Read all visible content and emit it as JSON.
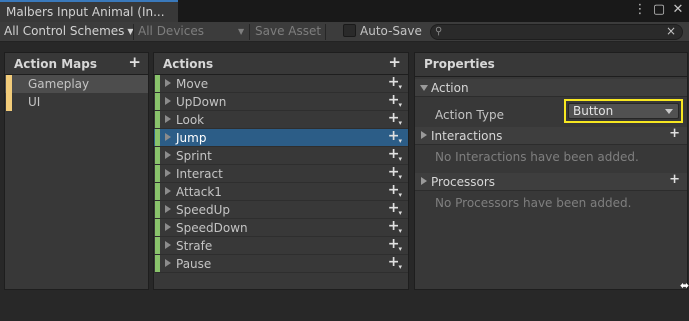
{
  "window": {
    "tab_title": "Malbers Input Animal (In...",
    "icons": [
      "more-icon",
      "maximize-icon",
      "close-icon"
    ],
    "icon_glyphs": {
      "more": "⋮",
      "maximize": "▢",
      "close": "✕"
    }
  },
  "toolbar": {
    "control_schemes": "All Control Schemes",
    "devices": "All Devices",
    "save_asset": "Save Asset",
    "auto_save": "Auto-Save",
    "auto_save_checked": false,
    "search_placeholder": "",
    "search_clear": "×"
  },
  "action_maps": {
    "header": "Action Maps",
    "items": [
      {
        "label": "Gameplay",
        "selected": true
      },
      {
        "label": "UI",
        "selected": false
      }
    ]
  },
  "actions": {
    "header": "Actions",
    "items": [
      {
        "label": "Move",
        "selected": false
      },
      {
        "label": "UpDown",
        "selected": false
      },
      {
        "label": "Look",
        "selected": false
      },
      {
        "label": "Jump",
        "selected": true
      },
      {
        "label": "Sprint",
        "selected": false
      },
      {
        "label": "Interact",
        "selected": false
      },
      {
        "label": "Attack1",
        "selected": false
      },
      {
        "label": "SpeedUp",
        "selected": false
      },
      {
        "label": "SpeedDown",
        "selected": false
      },
      {
        "label": "Strafe",
        "selected": false
      },
      {
        "label": "Pause",
        "selected": false
      }
    ]
  },
  "properties": {
    "header": "Properties",
    "action_section": "Action",
    "action_type_label": "Action Type",
    "action_type_value": "Button",
    "interactions_section": "Interactions",
    "interactions_empty": "No Interactions have been added.",
    "processors_section": "Processors",
    "processors_empty": "No Processors have been added."
  },
  "colors": {
    "accent_blue": "#3a79bb",
    "selection": "#2c5d87",
    "map_marker": "#f2cc7a",
    "action_marker": "#89c36b",
    "highlight_outline": "#f7e721"
  }
}
